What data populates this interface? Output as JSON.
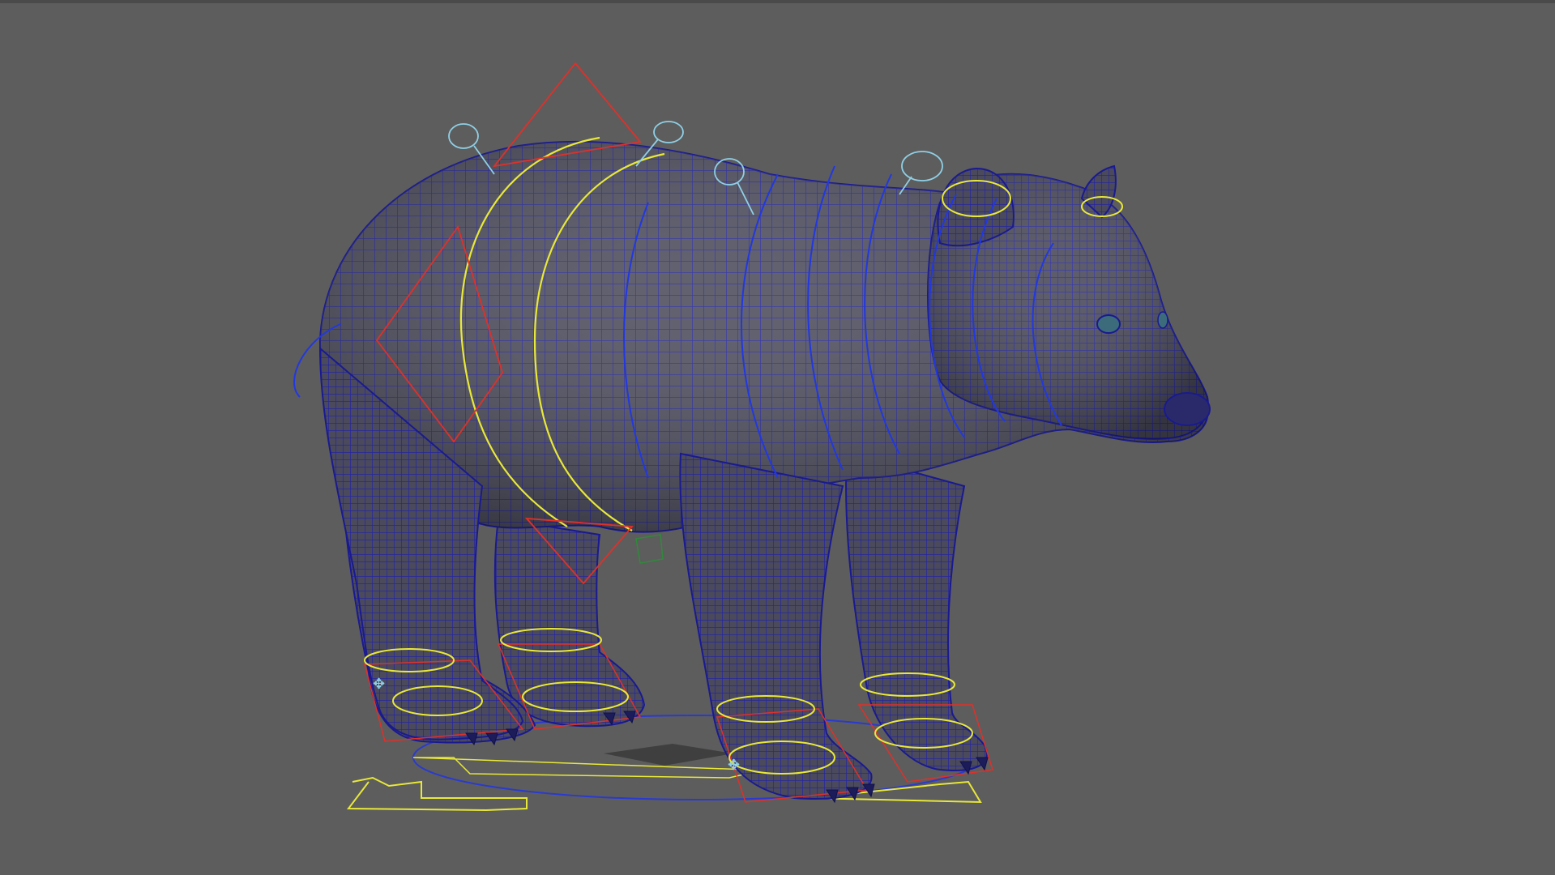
{
  "viewport": {
    "background_color": "#5d5d5d",
    "model": "bear-rig",
    "colors": {
      "mesh_fill": "#4d4d5c",
      "mesh_wire": "#1a1aa8",
      "fk_control": "#e8e83a",
      "ik_control": "#e0302a",
      "joint_control": "#8fd0e6",
      "root_control": "#e8e83a",
      "shadow": "#3f3f3f",
      "pivot_green": "#2f8a3a"
    }
  }
}
